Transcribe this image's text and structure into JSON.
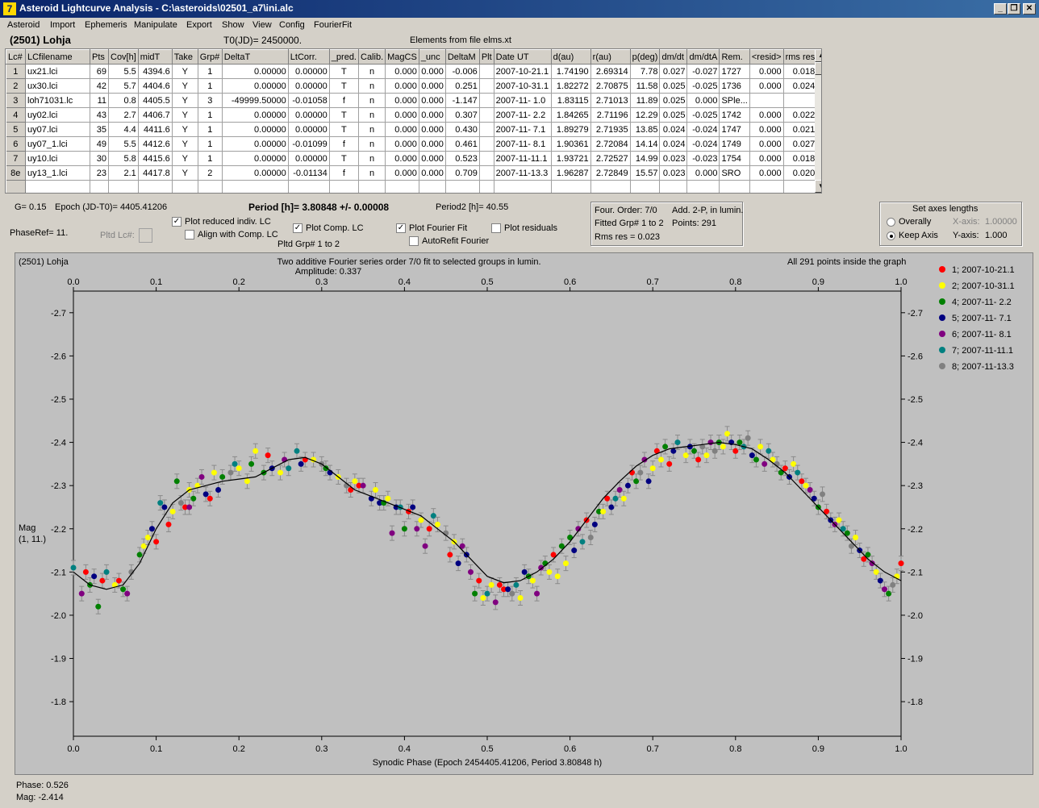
{
  "window": {
    "title": "Asteroid Lightcurve Analysis - C:\\asteroids\\02501_a7\\ini.alc",
    "app_icon": "7",
    "min_icon": "minimize-icon",
    "max_icon": "restore-icon",
    "close_icon": "close-icon"
  },
  "menu": [
    "Asteroid",
    "Import",
    "Ephemeris",
    "Manipulate",
    "Export",
    "Show",
    "View",
    "Config",
    "FourierFit"
  ],
  "header": {
    "asteroid": "(2501) Lohja",
    "t0": "T0(JD)= 2450000.",
    "elements": "Elements from file elms.xt"
  },
  "table": {
    "columns": [
      "Lc#",
      "LCfilename",
      "Pts",
      "Cov[h]",
      "midT",
      "Take",
      "Grp#",
      "DeltaT",
      "LtCorr.",
      "_pred.",
      "Calib.",
      "MagCS",
      "_unc",
      "DeltaM",
      "Plt",
      "Date UT",
      "d(au)",
      "r(au)",
      "p(deg)",
      "dm/dt",
      "dm/dtA",
      "Rem.",
      "<resid>",
      "rms res"
    ],
    "rows": [
      [
        "1",
        "ux21.lci",
        "69",
        "5.5",
        "4394.6",
        "Y",
        "1",
        "0.00000",
        "0.00000",
        "T",
        "n",
        "0.000",
        "0.000",
        "-0.006",
        "",
        "2007-10-21.1",
        "1.74190",
        "2.69314",
        "7.78",
        "0.027",
        "-0.027",
        "1727",
        "0.000",
        "0.018"
      ],
      [
        "2",
        "ux30.lci",
        "42",
        "5.7",
        "4404.6",
        "Y",
        "1",
        "0.00000",
        "0.00000",
        "T",
        "n",
        "0.000",
        "0.000",
        "0.251",
        "",
        "2007-10-31.1",
        "1.82272",
        "2.70875",
        "11.58",
        "0.025",
        "-0.025",
        "1736",
        "0.000",
        "0.024"
      ],
      [
        "3",
        "loh71031.lc",
        "11",
        "0.8",
        "4405.5",
        "Y",
        "3",
        "-49999.50000",
        "-0.01058",
        "f",
        "n",
        "0.000",
        "0.000",
        "-1.147",
        "",
        "2007-11- 1.0",
        "1.83115",
        "2.71013",
        "11.89",
        "0.025",
        "0.000",
        "SPle...",
        "",
        ""
      ],
      [
        "4",
        "uy02.lci",
        "43",
        "2.7",
        "4406.7",
        "Y",
        "1",
        "0.00000",
        "0.00000",
        "T",
        "n",
        "0.000",
        "0.000",
        "0.307",
        "",
        "2007-11- 2.2",
        "1.84265",
        "2.71196",
        "12.29",
        "0.025",
        "-0.025",
        "1742",
        "0.000",
        "0.022"
      ],
      [
        "5",
        "uy07.lci",
        "35",
        "4.4",
        "4411.6",
        "Y",
        "1",
        "0.00000",
        "0.00000",
        "T",
        "n",
        "0.000",
        "0.000",
        "0.430",
        "",
        "2007-11- 7.1",
        "1.89279",
        "2.71935",
        "13.85",
        "0.024",
        "-0.024",
        "1747",
        "0.000",
        "0.021"
      ],
      [
        "6",
        "uy07_1.lci",
        "49",
        "5.5",
        "4412.6",
        "Y",
        "1",
        "0.00000",
        "-0.01099",
        "f",
        "n",
        "0.000",
        "0.000",
        "0.461",
        "",
        "2007-11- 8.1",
        "1.90361",
        "2.72084",
        "14.14",
        "0.024",
        "-0.024",
        "1749",
        "0.000",
        "0.027"
      ],
      [
        "7",
        "uy10.lci",
        "30",
        "5.8",
        "4415.6",
        "Y",
        "1",
        "0.00000",
        "0.00000",
        "T",
        "n",
        "0.000",
        "0.000",
        "0.523",
        "",
        "2007-11-11.1",
        "1.93721",
        "2.72527",
        "14.99",
        "0.023",
        "-0.023",
        "1754",
        "0.000",
        "0.018"
      ],
      [
        "8e",
        "uy13_1.lci",
        "23",
        "2.1",
        "4417.8",
        "Y",
        "2",
        "0.00000",
        "-0.01134",
        "f",
        "n",
        "0.000",
        "0.000",
        "0.709",
        "",
        "2007-11-13.3",
        "1.96287",
        "2.72849",
        "15.57",
        "0.023",
        "0.000",
        "SRO",
        "0.000",
        "0.020"
      ]
    ]
  },
  "params": {
    "g": "G= 0.15",
    "epoch": "Epoch (JD-T0)= 4405.41206",
    "period": "Period [h]= 3.80848 +/- 0.00008",
    "period2": "Period2 [h]= 40.55",
    "phase_ref": "PhaseRef= 11.",
    "pltd_lc": "Pltd Lc#:",
    "pltd_grp": "Pltd Grp#  1  to  2"
  },
  "checkboxes": {
    "plot_reduced": {
      "label": "Plot reduced indiv. LC",
      "checked": true
    },
    "align_comp": {
      "label": "Align with Comp. LC",
      "checked": false
    },
    "plot_comp": {
      "label": "Plot Comp. LC",
      "checked": true
    },
    "plot_fourier": {
      "label": "Plot Fourier Fit",
      "checked": true
    },
    "autorefit": {
      "label": "AutoRefit Fourier",
      "checked": false
    },
    "plot_residuals": {
      "label": "Plot residuals",
      "checked": false
    }
  },
  "fourier_info": {
    "order": "Four. Order:  7/0",
    "add": "Add. 2-P, in lumin.",
    "fitted": "Fitted Grp# 1 to 2",
    "points": "Points: 291",
    "rms": "Rms res     = 0.023"
  },
  "axes_box": {
    "title": "Set axes lengths",
    "overally": "Overally",
    "keep": "Keep Axis",
    "xaxis_label": "X-axis:",
    "xaxis_value": "1.00000",
    "yaxis_label": "Y-axis:",
    "yaxis_value": "1.000",
    "selected": "keep"
  },
  "footer": {
    "phase": "Phase:  0.526",
    "mag": "Mag:    -2.414"
  },
  "chart_data": {
    "type": "scatter",
    "title_left": "(2501) Lohja",
    "title": "Two additive Fourier series order 7/0 fit to selected groups in lumin.",
    "amplitude": "Amplitude: 0.337",
    "title_right": "All 291 points inside the graph",
    "xlabel": "Synodic Phase (Epoch 2454405.41206, Period 3.80848 h)",
    "ylabel": "Mag",
    "ylabel2": "(1, 11.)",
    "xlim": [
      0.0,
      1.0
    ],
    "ylim": [
      -2.75,
      -1.72
    ],
    "y_inverted": true,
    "xticks": [
      "0.0",
      "0.1",
      "0.2",
      "0.3",
      "0.4",
      "0.5",
      "0.6",
      "0.7",
      "0.8",
      "0.9",
      "1.0"
    ],
    "yticks": [
      "-2.7",
      "-2.6",
      "-2.5",
      "-2.4",
      "-2.3",
      "-2.2",
      "-2.1",
      "-2.0",
      "-1.9",
      "-1.8"
    ],
    "yvals": [
      -2.7,
      -2.6,
      -2.5,
      -2.4,
      -2.3,
      -2.2,
      -2.1,
      -2.0,
      -1.9,
      -1.8
    ],
    "series": [
      {
        "name": "1; 2007-10-21.1",
        "color": "#ff0000"
      },
      {
        "name": "2; 2007-10-31.1",
        "color": "#ffff00"
      },
      {
        "name": "4; 2007-11- 2.2",
        "color": "#008000"
      },
      {
        "name": "5; 2007-11- 7.1",
        "color": "#000080"
      },
      {
        "name": "6; 2007-11- 8.1",
        "color": "#800080"
      },
      {
        "name": "7; 2007-11-11.1",
        "color": "#008080"
      },
      {
        "name": "8; 2007-11-13.3",
        "color": "#808080"
      }
    ],
    "fit_curve": {
      "x": [
        0.0,
        0.02,
        0.04,
        0.06,
        0.08,
        0.1,
        0.12,
        0.14,
        0.16,
        0.18,
        0.2,
        0.22,
        0.24,
        0.26,
        0.28,
        0.3,
        0.32,
        0.34,
        0.36,
        0.38,
        0.4,
        0.42,
        0.44,
        0.46,
        0.48,
        0.5,
        0.52,
        0.54,
        0.56,
        0.58,
        0.6,
        0.62,
        0.64,
        0.66,
        0.68,
        0.7,
        0.72,
        0.74,
        0.76,
        0.78,
        0.8,
        0.82,
        0.84,
        0.86,
        0.88,
        0.9,
        0.92,
        0.94,
        0.96,
        0.98,
        1.0
      ],
      "y": [
        -2.1,
        -2.07,
        -2.06,
        -2.07,
        -2.12,
        -2.2,
        -2.26,
        -2.29,
        -2.3,
        -2.31,
        -2.315,
        -2.32,
        -2.34,
        -2.36,
        -2.365,
        -2.35,
        -2.32,
        -2.29,
        -2.275,
        -2.26,
        -2.245,
        -2.23,
        -2.2,
        -2.17,
        -2.13,
        -2.09,
        -2.075,
        -2.08,
        -2.1,
        -2.13,
        -2.17,
        -2.22,
        -2.27,
        -2.31,
        -2.345,
        -2.37,
        -2.385,
        -2.39,
        -2.395,
        -2.4,
        -2.395,
        -2.385,
        -2.36,
        -2.33,
        -2.29,
        -2.25,
        -2.21,
        -2.17,
        -2.13,
        -2.1,
        -2.08
      ]
    },
    "points": [
      [
        0.0,
        -2.11,
        5
      ],
      [
        0.01,
        -2.05,
        4
      ],
      [
        0.015,
        -2.1,
        0
      ],
      [
        0.02,
        -2.07,
        2
      ],
      [
        0.025,
        -2.09,
        3
      ],
      [
        0.03,
        -2.02,
        2
      ],
      [
        0.035,
        -2.08,
        0
      ],
      [
        0.04,
        -2.1,
        5
      ],
      [
        0.05,
        -2.07,
        1
      ],
      [
        0.055,
        -2.08,
        0
      ],
      [
        0.06,
        -2.06,
        2
      ],
      [
        0.07,
        -2.1,
        6
      ],
      [
        0.08,
        -2.14,
        2
      ],
      [
        0.085,
        -2.16,
        1
      ],
      [
        0.09,
        -2.18,
        1
      ],
      [
        0.095,
        -2.2,
        3
      ],
      [
        0.1,
        -2.17,
        0
      ],
      [
        0.105,
        -2.26,
        5
      ],
      [
        0.11,
        -2.25,
        3
      ],
      [
        0.115,
        -2.21,
        0
      ],
      [
        0.12,
        -2.24,
        1
      ],
      [
        0.125,
        -2.31,
        2
      ],
      [
        0.13,
        -2.26,
        6
      ],
      [
        0.135,
        -2.25,
        0
      ],
      [
        0.14,
        -2.29,
        1
      ],
      [
        0.145,
        -2.27,
        2
      ],
      [
        0.15,
        -2.3,
        1
      ],
      [
        0.155,
        -2.32,
        4
      ],
      [
        0.16,
        -2.28,
        3
      ],
      [
        0.165,
        -2.27,
        0
      ],
      [
        0.17,
        -2.33,
        1
      ],
      [
        0.175,
        -2.29,
        3
      ],
      [
        0.18,
        -2.32,
        2
      ],
      [
        0.19,
        -2.33,
        6
      ],
      [
        0.195,
        -2.35,
        5
      ],
      [
        0.2,
        -2.34,
        1
      ],
      [
        0.21,
        -2.31,
        1
      ],
      [
        0.215,
        -2.35,
        2
      ],
      [
        0.22,
        -2.38,
        1
      ],
      [
        0.23,
        -2.33,
        2
      ],
      [
        0.235,
        -2.37,
        0
      ],
      [
        0.24,
        -2.34,
        3
      ],
      [
        0.25,
        -2.33,
        1
      ],
      [
        0.255,
        -2.36,
        4
      ],
      [
        0.26,
        -2.34,
        5
      ],
      [
        0.27,
        -2.38,
        5
      ],
      [
        0.275,
        -2.35,
        3
      ],
      [
        0.28,
        -2.36,
        0
      ],
      [
        0.29,
        -2.36,
        1
      ],
      [
        0.3,
        -2.35,
        6
      ],
      [
        0.305,
        -2.34,
        2
      ],
      [
        0.31,
        -2.33,
        3
      ],
      [
        0.32,
        -2.32,
        1
      ],
      [
        0.33,
        -2.3,
        6
      ],
      [
        0.335,
        -2.29,
        0
      ],
      [
        0.34,
        -2.31,
        1
      ],
      [
        0.345,
        -2.3,
        0
      ],
      [
        0.35,
        -2.3,
        4
      ],
      [
        0.36,
        -2.27,
        3
      ],
      [
        0.365,
        -2.29,
        1
      ],
      [
        0.37,
        -2.26,
        3
      ],
      [
        0.375,
        -2.26,
        2
      ],
      [
        0.38,
        -2.27,
        1
      ],
      [
        0.385,
        -2.19,
        4
      ],
      [
        0.39,
        -2.25,
        3
      ],
      [
        0.395,
        -2.25,
        5
      ],
      [
        0.4,
        -2.2,
        2
      ],
      [
        0.405,
        -2.24,
        0
      ],
      [
        0.41,
        -2.25,
        3
      ],
      [
        0.415,
        -2.2,
        4
      ],
      [
        0.42,
        -2.22,
        1
      ],
      [
        0.425,
        -2.16,
        4
      ],
      [
        0.43,
        -2.2,
        0
      ],
      [
        0.435,
        -2.23,
        5
      ],
      [
        0.44,
        -2.21,
        1
      ],
      [
        0.45,
        -2.19,
        6
      ],
      [
        0.455,
        -2.14,
        0
      ],
      [
        0.46,
        -2.17,
        1
      ],
      [
        0.465,
        -2.12,
        3
      ],
      [
        0.47,
        -2.16,
        4
      ],
      [
        0.475,
        -2.14,
        3
      ],
      [
        0.48,
        -2.1,
        4
      ],
      [
        0.485,
        -2.05,
        2
      ],
      [
        0.49,
        -2.08,
        0
      ],
      [
        0.495,
        -2.04,
        1
      ],
      [
        0.5,
        -2.05,
        5
      ],
      [
        0.505,
        -2.07,
        1
      ],
      [
        0.51,
        -2.03,
        4
      ],
      [
        0.515,
        -2.07,
        0
      ],
      [
        0.52,
        -2.06,
        0
      ],
      [
        0.525,
        -2.06,
        3
      ],
      [
        0.53,
        -2.05,
        6
      ],
      [
        0.535,
        -2.07,
        5
      ],
      [
        0.54,
        -2.04,
        1
      ],
      [
        0.545,
        -2.1,
        3
      ],
      [
        0.55,
        -2.09,
        2
      ],
      [
        0.555,
        -2.08,
        1
      ],
      [
        0.56,
        -2.05,
        4
      ],
      [
        0.565,
        -2.11,
        4
      ],
      [
        0.57,
        -2.12,
        2
      ],
      [
        0.575,
        -2.1,
        1
      ],
      [
        0.58,
        -2.14,
        0
      ],
      [
        0.585,
        -2.09,
        1
      ],
      [
        0.59,
        -2.16,
        2
      ],
      [
        0.595,
        -2.12,
        1
      ],
      [
        0.6,
        -2.18,
        2
      ],
      [
        0.605,
        -2.15,
        3
      ],
      [
        0.61,
        -2.2,
        4
      ],
      [
        0.615,
        -2.17,
        5
      ],
      [
        0.62,
        -2.22,
        0
      ],
      [
        0.625,
        -2.18,
        6
      ],
      [
        0.63,
        -2.21,
        3
      ],
      [
        0.635,
        -2.24,
        2
      ],
      [
        0.64,
        -2.24,
        1
      ],
      [
        0.645,
        -2.27,
        0
      ],
      [
        0.65,
        -2.25,
        3
      ],
      [
        0.655,
        -2.27,
        5
      ],
      [
        0.66,
        -2.29,
        4
      ],
      [
        0.665,
        -2.27,
        1
      ],
      [
        0.67,
        -2.3,
        3
      ],
      [
        0.675,
        -2.33,
        0
      ],
      [
        0.68,
        -2.31,
        2
      ],
      [
        0.685,
        -2.33,
        6
      ],
      [
        0.69,
        -2.36,
        4
      ],
      [
        0.695,
        -2.31,
        3
      ],
      [
        0.7,
        -2.34,
        1
      ],
      [
        0.705,
        -2.38,
        0
      ],
      [
        0.71,
        -2.36,
        1
      ],
      [
        0.715,
        -2.39,
        2
      ],
      [
        0.72,
        -2.35,
        0
      ],
      [
        0.725,
        -2.38,
        3
      ],
      [
        0.73,
        -2.4,
        5
      ],
      [
        0.74,
        -2.37,
        1
      ],
      [
        0.745,
        -2.39,
        3
      ],
      [
        0.75,
        -2.38,
        2
      ],
      [
        0.755,
        -2.36,
        0
      ],
      [
        0.76,
        -2.39,
        6
      ],
      [
        0.765,
        -2.37,
        1
      ],
      [
        0.77,
        -2.4,
        4
      ],
      [
        0.775,
        -2.38,
        6
      ],
      [
        0.78,
        -2.4,
        2
      ],
      [
        0.785,
        -2.39,
        1
      ],
      [
        0.79,
        -2.42,
        1
      ],
      [
        0.795,
        -2.4,
        3
      ],
      [
        0.8,
        -2.38,
        0
      ],
      [
        0.805,
        -2.4,
        2
      ],
      [
        0.81,
        -2.39,
        5
      ],
      [
        0.815,
        -2.41,
        6
      ],
      [
        0.82,
        -2.37,
        3
      ],
      [
        0.825,
        -2.36,
        2
      ],
      [
        0.83,
        -2.39,
        1
      ],
      [
        0.835,
        -2.35,
        4
      ],
      [
        0.84,
        -2.38,
        5
      ],
      [
        0.845,
        -2.36,
        1
      ],
      [
        0.85,
        -2.35,
        6
      ],
      [
        0.855,
        -2.33,
        2
      ],
      [
        0.86,
        -2.34,
        0
      ],
      [
        0.865,
        -2.32,
        3
      ],
      [
        0.87,
        -2.35,
        1
      ],
      [
        0.875,
        -2.33,
        5
      ],
      [
        0.88,
        -2.31,
        0
      ],
      [
        0.885,
        -2.3,
        1
      ],
      [
        0.89,
        -2.29,
        4
      ],
      [
        0.895,
        -2.27,
        3
      ],
      [
        0.9,
        -2.25,
        2
      ],
      [
        0.905,
        -2.28,
        6
      ],
      [
        0.91,
        -2.24,
        0
      ],
      [
        0.915,
        -2.22,
        3
      ],
      [
        0.92,
        -2.21,
        4
      ],
      [
        0.925,
        -2.22,
        1
      ],
      [
        0.93,
        -2.2,
        5
      ],
      [
        0.935,
        -2.19,
        2
      ],
      [
        0.94,
        -2.16,
        6
      ],
      [
        0.945,
        -2.18,
        1
      ],
      [
        0.95,
        -2.15,
        3
      ],
      [
        0.955,
        -2.13,
        0
      ],
      [
        0.96,
        -2.14,
        2
      ],
      [
        0.965,
        -2.12,
        4
      ],
      [
        0.97,
        -2.1,
        1
      ],
      [
        0.975,
        -2.08,
        3
      ],
      [
        0.98,
        -2.06,
        4
      ],
      [
        0.985,
        -2.05,
        2
      ],
      [
        0.99,
        -2.07,
        6
      ],
      [
        0.995,
        -2.09,
        1
      ],
      [
        1.0,
        -2.12,
        0
      ],
      [
        0.065,
        -2.05,
        4
      ],
      [
        0.14,
        -2.25,
        4
      ]
    ]
  }
}
